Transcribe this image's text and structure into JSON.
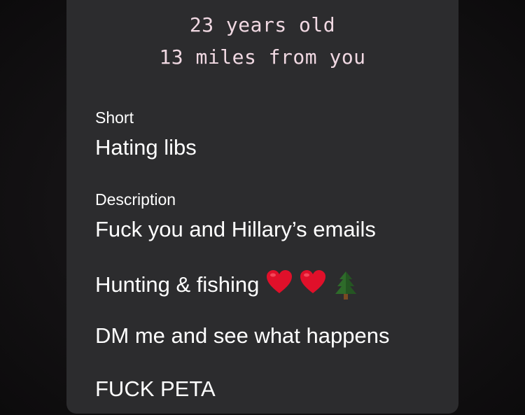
{
  "profile": {
    "age_text": "23 years old",
    "distance_text": "13 miles from you",
    "short": {
      "label": "Short",
      "value": "Hating libs"
    },
    "description": {
      "label": "Description",
      "lines": [
        "Fuck you and Hillary’s emails",
        "Hunting & fishing",
        "DM me and see what happens",
        "FUCK PETA"
      ],
      "emojis": [
        "red-heart-icon",
        "red-heart-icon",
        "evergreen-tree-icon"
      ]
    }
  },
  "colors": {
    "background": "#141214",
    "card": "#2c2c2e",
    "meta_text": "#f0d8e2",
    "body_text": "#ffffff",
    "heart": "#e0102a",
    "tree": "#2e6b2a"
  }
}
